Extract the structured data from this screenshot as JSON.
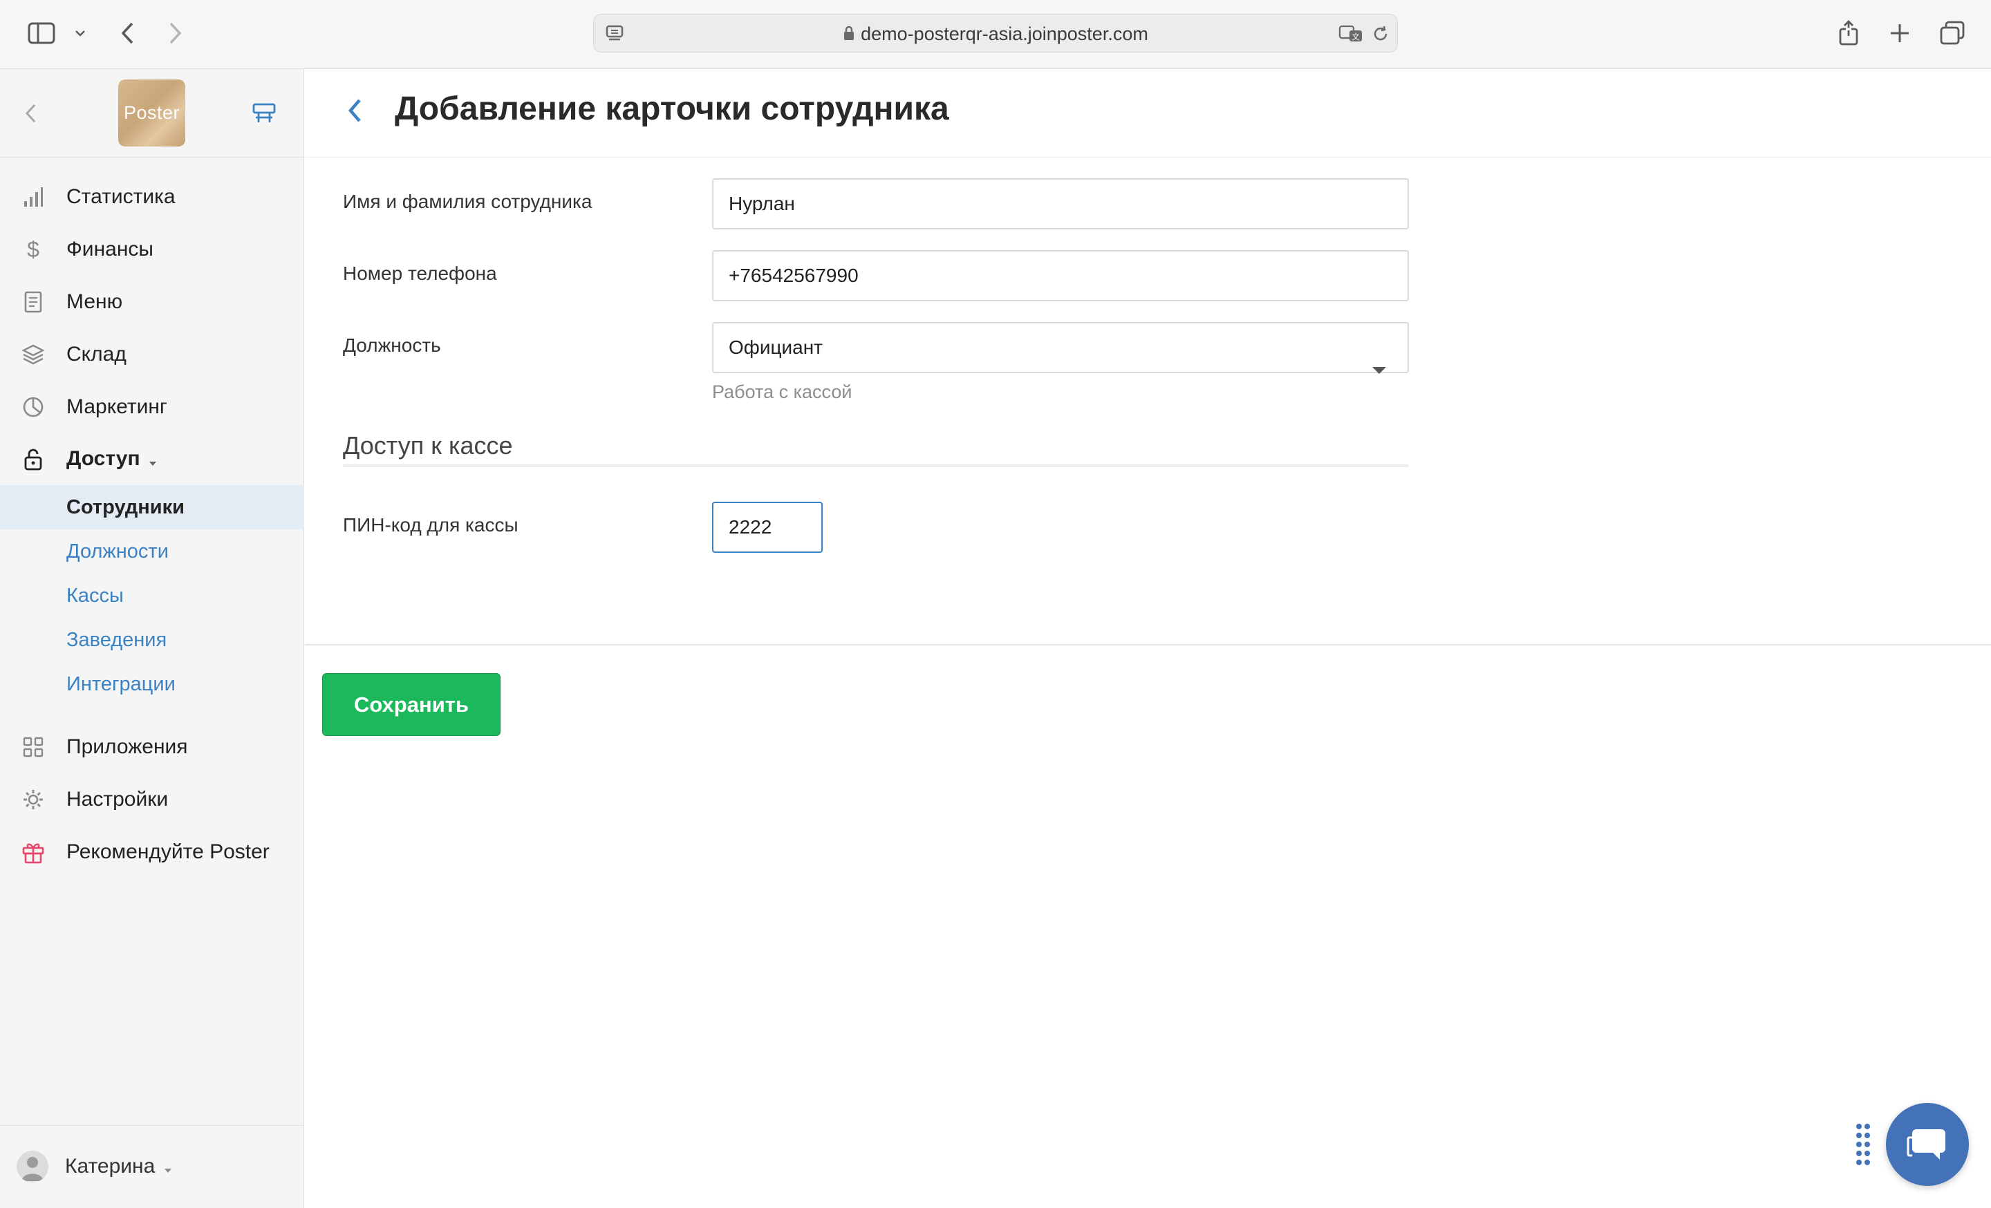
{
  "browser": {
    "url": "demo-posterqr-asia.joinposter.com"
  },
  "sidebar": {
    "logo_text": "Poster",
    "items": [
      {
        "label": "Статистика",
        "icon": "bar-chart-icon"
      },
      {
        "label": "Финансы",
        "icon": "dollar-icon"
      },
      {
        "label": "Меню",
        "icon": "document-icon"
      },
      {
        "label": "Склад",
        "icon": "layers-icon"
      },
      {
        "label": "Маркетинг",
        "icon": "pie-chart-icon"
      },
      {
        "label": "Доступ",
        "icon": "lock-icon"
      }
    ],
    "access_subitems": [
      {
        "label": "Сотрудники",
        "active": true
      },
      {
        "label": "Должности",
        "active": false
      },
      {
        "label": "Кассы",
        "active": false
      },
      {
        "label": "Заведения",
        "active": false
      },
      {
        "label": "Интеграции",
        "active": false
      }
    ],
    "bottom_items": [
      {
        "label": "Приложения",
        "icon": "grid-icon"
      },
      {
        "label": "Настройки",
        "icon": "gear-icon"
      },
      {
        "label": "Рекомендуйте Poster",
        "icon": "gift-icon"
      }
    ],
    "user": {
      "name": "Катерина"
    }
  },
  "page": {
    "title": "Добавление карточки сотрудника",
    "fields": {
      "name_label": "Имя и фамилия сотрудника",
      "name_value": "Нурлан",
      "phone_label": "Номер телефона",
      "phone_value": "+76542567990",
      "position_label": "Должность",
      "position_value": "Официант",
      "position_hint": "Работа с кассой"
    },
    "cash_section": {
      "title": "Доступ к кассе",
      "pin_label": "ПИН-код для кассы",
      "pin_value": "2222"
    },
    "save_label": "Сохранить"
  },
  "colors": {
    "accent": "#3b82c4",
    "save": "#1cb85c",
    "gift": "#e8456b",
    "chat": "#4472b8"
  }
}
